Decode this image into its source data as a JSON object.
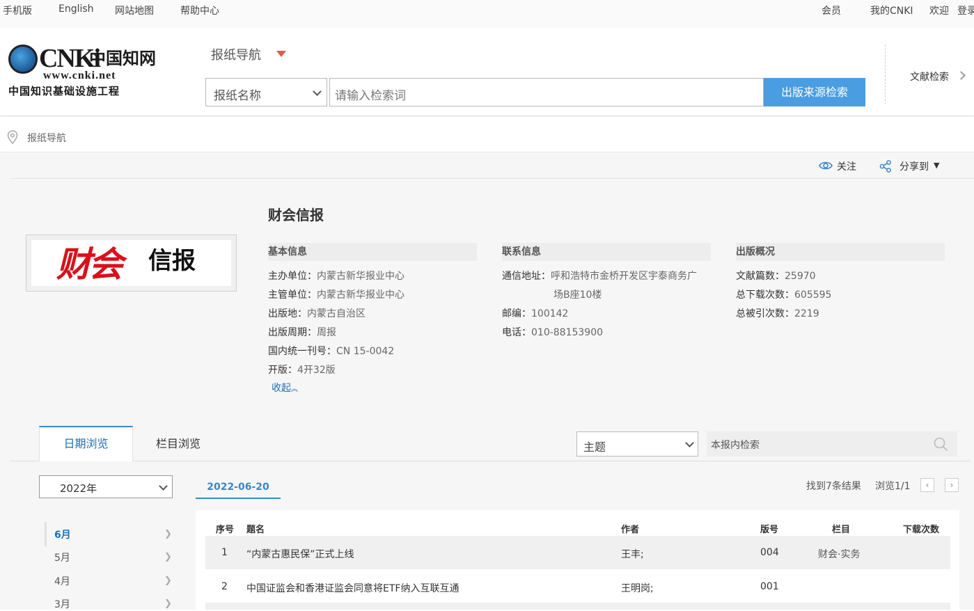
{
  "topbar": {
    "mobile": "手机版",
    "english": "English",
    "sitemap": "网站地图",
    "help": "帮助中心",
    "member": "会员",
    "my_cnki": "我的CNKI",
    "welcome": "欢迎",
    "login": "登录"
  },
  "logo": {
    "brand": "CNKi",
    "cn_name": "中国知网",
    "url": "www.cnki.net",
    "tagline": "中国知识基础设施工程"
  },
  "header": {
    "nav_title": "报纸导航",
    "search_type": "报纸名称",
    "search_placeholder": "请输入检索词",
    "search_button": "出版来源检索",
    "doc_search": "文献检索"
  },
  "breadcrumb": {
    "label": "报纸导航"
  },
  "actions": {
    "follow": "关注",
    "share": "分享到"
  },
  "paper": {
    "title": "财会信报",
    "cover_text": {
      "part1": "财会",
      "part2": "信报"
    },
    "basic": {
      "heading": "基本信息",
      "host_k": "主办单位：",
      "host_v": "内蒙古新华报业中心",
      "admin_k": "主管单位：",
      "admin_v": "内蒙古新华报业中心",
      "place_k": "出版地：",
      "place_v": "内蒙古自治区",
      "cycle_k": "出版周期：",
      "cycle_v": "周报",
      "cn_k": "国内统一刊号：",
      "cn_v": "CN 15-0042",
      "format_k": "开版：",
      "format_v": "4开32版",
      "collapse": "收起"
    },
    "contact": {
      "heading": "联系信息",
      "addr_k": "通信地址：",
      "addr_v1": "呼和浩特市金桥开发区宇泰商务广",
      "addr_v2": "场B座10楼",
      "zip_k": "邮编：",
      "zip_v": "100142",
      "tel_k": "电话：",
      "tel_v": "010-88153900"
    },
    "stats": {
      "heading": "出版概况",
      "docs_k": "文献篇数：",
      "docs_v": "25970",
      "downloads_k": "总下载次数：",
      "downloads_v": "605595",
      "cited_k": "总被引次数：",
      "cited_v": "2219"
    }
  },
  "tabs": {
    "date": "日期浏览",
    "column": "栏目浏览"
  },
  "inner_search": {
    "field": "主题",
    "placeholder": "本报内检索"
  },
  "year_select": "2022年",
  "months": [
    "6月",
    "5月",
    "4月",
    "3月"
  ],
  "date_tab": "2022-06-20",
  "results": {
    "found": "找到7条结果",
    "page": "浏览1/1"
  },
  "table": {
    "headers": {
      "no": "序号",
      "title": "题名",
      "author": "作者",
      "edition": "版号",
      "column": "栏目",
      "downloads": "下载次数"
    },
    "rows": [
      {
        "no": "1",
        "title": "“内蒙古惠民保”正式上线",
        "author": "王丰;",
        "edition": "004",
        "column": "财会·实务",
        "downloads": ""
      },
      {
        "no": "2",
        "title": "中国证监会和香港证监会同意将ETF纳入互联互通",
        "author": "王明岗;",
        "edition": "001",
        "column": "",
        "downloads": ""
      }
    ]
  },
  "colors": {
    "accent": "#1e6fb5",
    "search_btn": "#4a9de0",
    "cover_red": "#d8111b",
    "nav_arrow": "#e05a47"
  }
}
